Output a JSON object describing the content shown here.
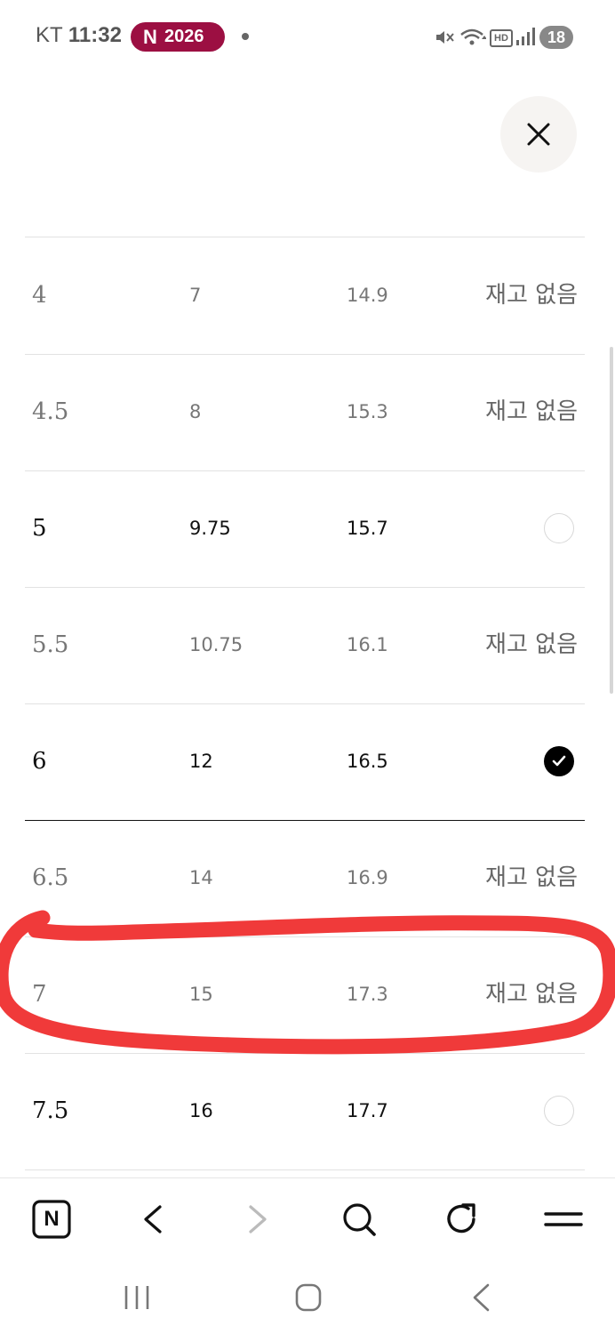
{
  "status_bar": {
    "carrier": "KT",
    "time": "11:32",
    "notification_badge_letter": "N",
    "notification_badge_text": "2026",
    "battery": "18",
    "network_label": "HD"
  },
  "close_label": "×",
  "table": {
    "rows": [
      {
        "size": "4",
        "col_b": "7",
        "col_c": "14.9",
        "status": "재고 없음",
        "state": "out"
      },
      {
        "size": "4.5",
        "col_b": "8",
        "col_c": "15.3",
        "status": "재고 없음",
        "state": "out"
      },
      {
        "size": "5",
        "col_b": "9.75",
        "col_c": "15.7",
        "status": "",
        "state": "available"
      },
      {
        "size": "5.5",
        "col_b": "10.75",
        "col_c": "16.1",
        "status": "재고 없음",
        "state": "out"
      },
      {
        "size": "6",
        "col_b": "12",
        "col_c": "16.5",
        "status": "",
        "state": "selected"
      },
      {
        "size": "6.5",
        "col_b": "14",
        "col_c": "16.9",
        "status": "재고 없음",
        "state": "out"
      },
      {
        "size": "7",
        "col_b": "15",
        "col_c": "17.3",
        "status": "재고 없음",
        "state": "out"
      },
      {
        "size": "7.5",
        "col_b": "16",
        "col_c": "17.7",
        "status": "",
        "state": "available"
      }
    ]
  },
  "toolbar": {
    "home_letter": "N"
  },
  "colors": {
    "annotation_red": "#f03a3a",
    "badge_bg": "#9c0f42"
  }
}
